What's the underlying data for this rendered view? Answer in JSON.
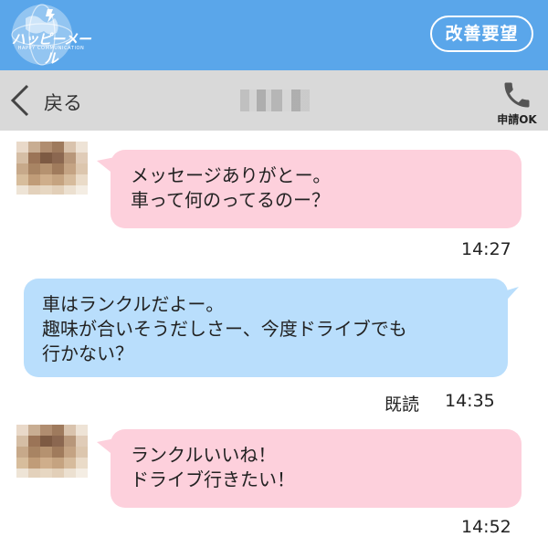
{
  "header": {
    "logo_text": "ハッピーメール",
    "logo_subtext": "HAPPY COMMUNICATION",
    "request_button": "改善要望"
  },
  "nav": {
    "back_label": "戻る",
    "nickname": "",
    "call_label": "申請OK"
  },
  "messages": [
    {
      "side": "incoming",
      "lines": [
        "メッセージありがとー。",
        "車って何のってるのー？"
      ],
      "time": "14:27",
      "status": ""
    },
    {
      "side": "outgoing",
      "lines": [
        "車はランクルだよー。",
        "趣味が合いそうだしさー、今度ドライブでも",
        "行かない？"
      ],
      "time": "14:35",
      "status": "既読"
    },
    {
      "side": "incoming",
      "lines": [
        "ランクルいいね！",
        "ドライブ行きたい！"
      ],
      "time": "14:52",
      "status": ""
    }
  ],
  "colors": {
    "header_bg": "#5aa6ea",
    "nav_bg": "#d9d9d9",
    "incoming_bubble": "#fdd0dc",
    "outgoing_bubble": "#b9defc"
  }
}
